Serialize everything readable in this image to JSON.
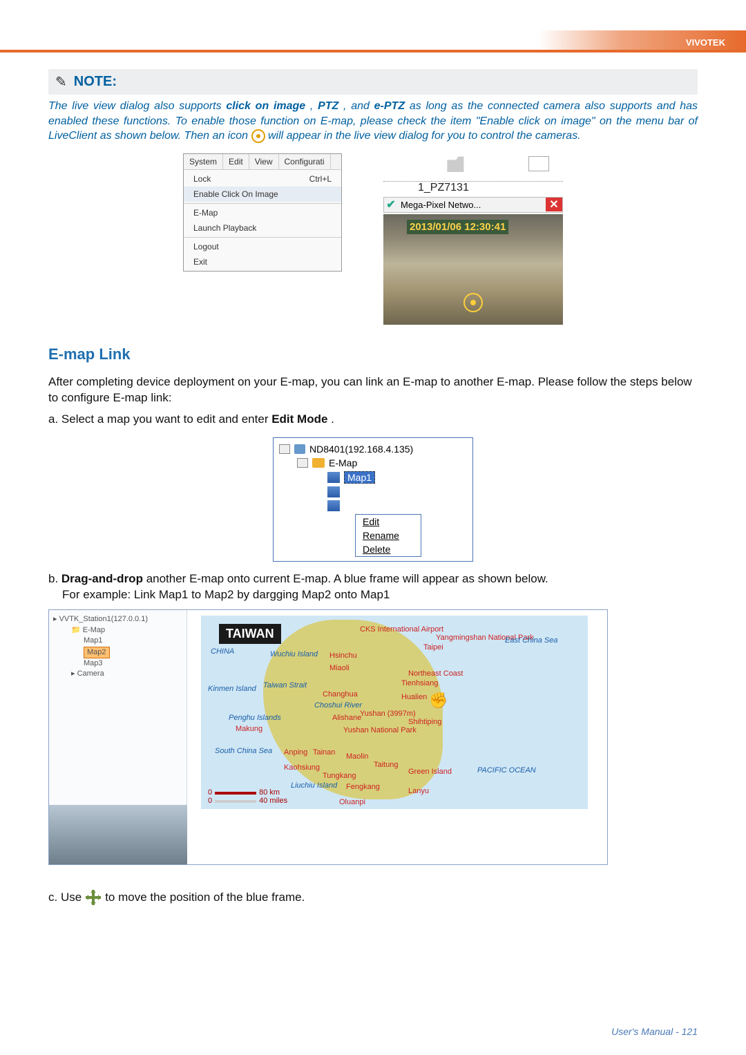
{
  "header": {
    "brand": "VIVOTEK"
  },
  "note": {
    "label": "NOTE:",
    "text_pre": "The live view dialog also supports ",
    "b1": "click on image",
    "t2": ", ",
    "b2": "PTZ",
    "t3": ", and ",
    "b3": "e-PTZ",
    "text_post": " as long as the connected camera also supports and has enabled these functions. To enable those function on E-map, please check the item \"Enable click on image\" on the menu bar of LiveClient as shown below. Then an icon ",
    "text_tail": " will appear in the live view dialog for you to control the cameras."
  },
  "menu_fig": {
    "tabs": [
      "System",
      "Edit",
      "View",
      "Configurati"
    ],
    "items": [
      {
        "label": "Lock",
        "shortcut": "Ctrl+L",
        "highlight": false
      },
      {
        "label": "Enable Click On Image",
        "shortcut": "",
        "highlight": true
      },
      {
        "label": "E-Map",
        "shortcut": "",
        "highlight": false
      },
      {
        "label": "Launch Playback",
        "shortcut": "",
        "highlight": false
      },
      {
        "label": "Logout",
        "shortcut": "",
        "highlight": false
      },
      {
        "label": "Exit",
        "shortcut": "",
        "highlight": false
      }
    ]
  },
  "live_fig": {
    "device": "1_PZ7131",
    "bar_text": "Mega-Pixel Netwo...",
    "timestamp": "2013/01/06 12:30:41"
  },
  "section": {
    "heading": "E-map Link",
    "intro": "After completing device deployment on your E-map, you can link an E-map to another E-map. Please follow the steps below to configure E-map link:",
    "step_a": "a. Select a map you want to edit and enter ",
    "step_a_b": "Edit Mode",
    "step_a_tail": "."
  },
  "tree": {
    "nvr": "ND8401(192.168.4.135)",
    "folder": "E-Map",
    "selected": "Map1",
    "menu": [
      "Edit",
      "Rename",
      "Delete"
    ]
  },
  "step_b": {
    "pre": "b. ",
    "bold": "Drag-and-drop",
    "post": " another E-map onto current E-map. A blue frame will appear as shown below.",
    "line2": "For example: Link Map1 to Map2 by dargging Map2 onto Map1"
  },
  "big_fig": {
    "station": "VVTK_Station1(127.0.0.1)",
    "folder": "E-Map",
    "items": [
      "Map1",
      "Map2",
      "Map3"
    ],
    "camera": "Camera",
    "map_title": "TAIWAN",
    "scale1": "80 km",
    "scale2": "40 miles",
    "labels": {
      "cks": "CKS International Airport",
      "taipei": "Taipei",
      "east": "East China Sea",
      "yang": "Yangmingshan National Park",
      "china": "CHINA",
      "wuchiu": "Wuchiu Island",
      "hsinchu": "Hsinchu",
      "miaoli": "Miaoli",
      "kinmen": "Kinmen Island",
      "strait": "Taiwan Strait",
      "tienhsiang": "Tienhsiang",
      "changhua": "Changhua",
      "hualien": "Hualien",
      "penghu": "Penghu Islands",
      "alishane": "Alishane",
      "yushan": "Yushan (3997m)",
      "makung": "Makung",
      "shihtiping": "Shihtiping",
      "yushanpark": "Yushan National Park",
      "south": "South China Sea",
      "anping": "Anping",
      "tainan": "Tainan",
      "maolin": "Maolin",
      "taitung": "Taitung",
      "kaohsiung": "Kaohsiung",
      "tungkang": "Tungkang",
      "green": "Green Island",
      "pacific": "PACIFIC OCEAN",
      "liuchiu": "Liuchiu Island",
      "fengkang": "Fengkang",
      "lanyu": "Lanyu",
      "oluanpi": "Oluanpi",
      "river": "Choshui River",
      "northeast": "Northeast Coast"
    }
  },
  "step_c": {
    "pre": "c. Use ",
    "post": " to move the position of the blue frame."
  },
  "footer": {
    "text": "User's Manual - 121"
  }
}
